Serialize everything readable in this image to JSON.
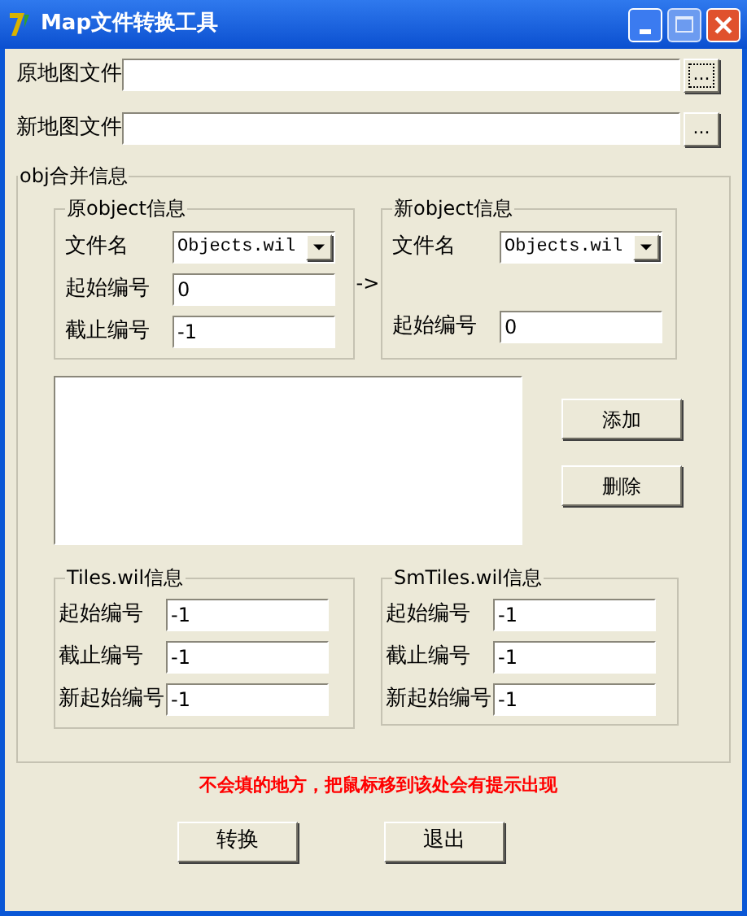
{
  "window": {
    "title": "Map文件转换工具"
  },
  "file_rows": [
    {
      "label": "原地图文件",
      "button": "...",
      "focused": true
    },
    {
      "label": "新地图文件",
      "button": "...",
      "focused": false
    }
  ],
  "obj_group": {
    "title": "obj合并信息",
    "source": {
      "title": "原object信息",
      "fields": [
        {
          "kind": "dropdown",
          "label": "文件名",
          "value": "Objects.wil"
        },
        {
          "kind": "text",
          "label": "起始编号",
          "value": "0"
        },
        {
          "kind": "text",
          "label": "截止编号",
          "value": "-1"
        }
      ]
    },
    "arrow": "->",
    "target": {
      "title": "新object信息",
      "fields": [
        {
          "kind": "dropdown",
          "label": "文件名",
          "value": "Objects.wil"
        },
        {
          "kind": "text",
          "label": "起始编号",
          "value": "0"
        }
      ]
    },
    "list_buttons": [
      "添加",
      "删除"
    ],
    "tiles": {
      "title": "Tiles.wil信息",
      "fields": [
        {
          "kind": "text",
          "label": "起始编号",
          "value": "-1"
        },
        {
          "kind": "text",
          "label": "截止编号",
          "value": "-1"
        },
        {
          "kind": "text",
          "label": "新起始编号",
          "value": "-1"
        }
      ]
    },
    "smtiles": {
      "title": "SmTiles.wil信息",
      "fields": [
        {
          "kind": "text",
          "label": "起始编号",
          "value": "-1"
        },
        {
          "kind": "text",
          "label": "截止编号",
          "value": "-1"
        },
        {
          "kind": "text",
          "label": "新起始编号",
          "value": "-1"
        }
      ]
    }
  },
  "hint": "不会填的地方，把鼠标移到该处会有提示出现",
  "buttons": [
    "转换",
    "退出"
  ]
}
